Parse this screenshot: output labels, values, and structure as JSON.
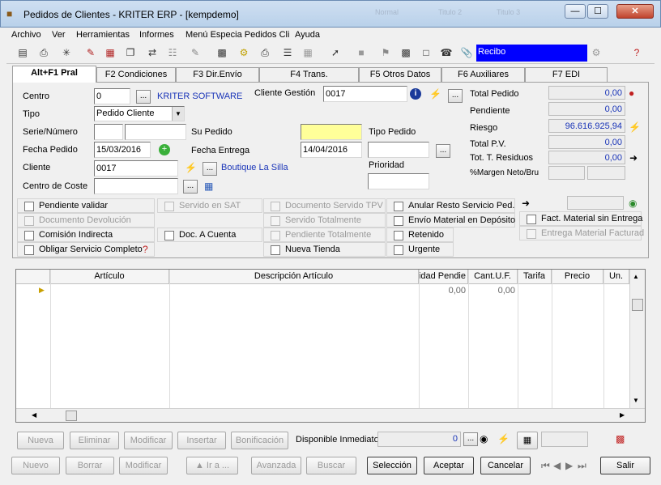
{
  "window": {
    "title": "Pedidos de Clientes - KRITER ERP - [kempdemo]",
    "ghost_labels": [
      "Normal",
      "Titulo 2",
      "Titulo 3"
    ]
  },
  "menu": [
    "Archivo",
    "Ver",
    "Herramientas",
    "Informes",
    "Menú Especia Pedidos Cli",
    "Ayuda"
  ],
  "toolbar": {
    "recibo": "Recibo"
  },
  "tabs": [
    "Alt+F1 Pral",
    "F2 Condiciones",
    "F3 Dir.Envío",
    "F4 Trans.",
    "F5 Otros Datos",
    "F6 Auxiliares",
    "F7 EDI"
  ],
  "form": {
    "centro_label": "Centro",
    "centro_value": "0",
    "centro_name": "KRITER SOFTWARE",
    "tipo_label": "Tipo",
    "tipo_value": "Pedido Cliente",
    "serie_label": "Serie/Número",
    "serie_value": "",
    "numero_value": "",
    "fecha_pedido_label": "Fecha Pedido",
    "fecha_pedido_value": "15/03/2016",
    "cliente_label": "Cliente",
    "cliente_value": "0017",
    "cliente_name": "Boutique La Silla",
    "centro_coste_label": "Centro de Coste",
    "centro_coste_value": "",
    "cliente_gestion_label": "Cliente Gestión",
    "cliente_gestion_value": "0017",
    "su_pedido_label": "Su Pedido",
    "su_pedido_value": "",
    "fecha_entrega_label": "Fecha Entrega",
    "fecha_entrega_value": "14/04/2016",
    "tipo_pedido_label": "Tipo Pedido",
    "tipo_pedido_value": "",
    "prioridad_label": "Prioridad",
    "prioridad_value": ""
  },
  "totals": [
    {
      "label": "Total Pedido",
      "value": "0,00"
    },
    {
      "label": "Pendiente",
      "value": "0,00"
    },
    {
      "label": "Riesgo",
      "value": "96.616.925,94"
    },
    {
      "label": "Total P.V.",
      "value": "0,00"
    },
    {
      "label": "Tot. T. Residuos",
      "value": "0,00"
    },
    {
      "label": "%Margen Neto/Bru",
      "value": ""
    }
  ],
  "checks": {
    "pendiente_validar": "Pendiente validar",
    "documento_devolucion": "Documento Devolución",
    "comision_indirecta": "Comisión Indirecta",
    "obligar_servicio": "Obligar Servicio Completo",
    "servido_sat": "Servido en SAT",
    "doc_a_cuenta": "Doc. A Cuenta",
    "documento_servido_tpv": "Documento Servido TPV",
    "servido_totalmente": "Servido Totalmente",
    "pendiente_totalmente": "Pendiente Totalmente",
    "nueva_tienda": "Nueva Tienda",
    "anular_resto": "Anular Resto Servicio Ped.",
    "envio_material": "Envío Material en Depósito",
    "retenido": "Retenido",
    "urgente": "Urgente",
    "fact_material": "Fact. Material sin Entrega",
    "entrega_material": "Entrega Material Facturad"
  },
  "grid": {
    "columns": [
      "",
      "Artículo",
      "Descripción Artículo",
      "Cantidad Pendie",
      "Cant.U.F.",
      "Tarifa",
      "Precio",
      "Un."
    ],
    "row": [
      "",
      "",
      "",
      "0,00",
      "0,00",
      "",
      "",
      ""
    ]
  },
  "lines_bar": {
    "nueva": "Nueva",
    "eliminar": "Eliminar",
    "modificar": "Modificar",
    "insertar": "Insertar",
    "bonificacion": "Bonificación",
    "disponible_label": "Disponible Inmediato",
    "disponible_value": "0"
  },
  "bottom_bar": {
    "nuevo": "Nuevo",
    "borrar": "Borrar",
    "modificar": "Modificar",
    "ir_a": "▲ Ir a ...",
    "avanzada": "Avanzada",
    "buscar": "Buscar",
    "seleccion": "Selección",
    "aceptar": "Aceptar",
    "cancelar": "Cancelar",
    "salir": "Salir"
  },
  "colors": {
    "accent_blue": "#0000ff",
    "link_blue": "#1a35b8",
    "highlight_yellow": "#ffff99"
  }
}
